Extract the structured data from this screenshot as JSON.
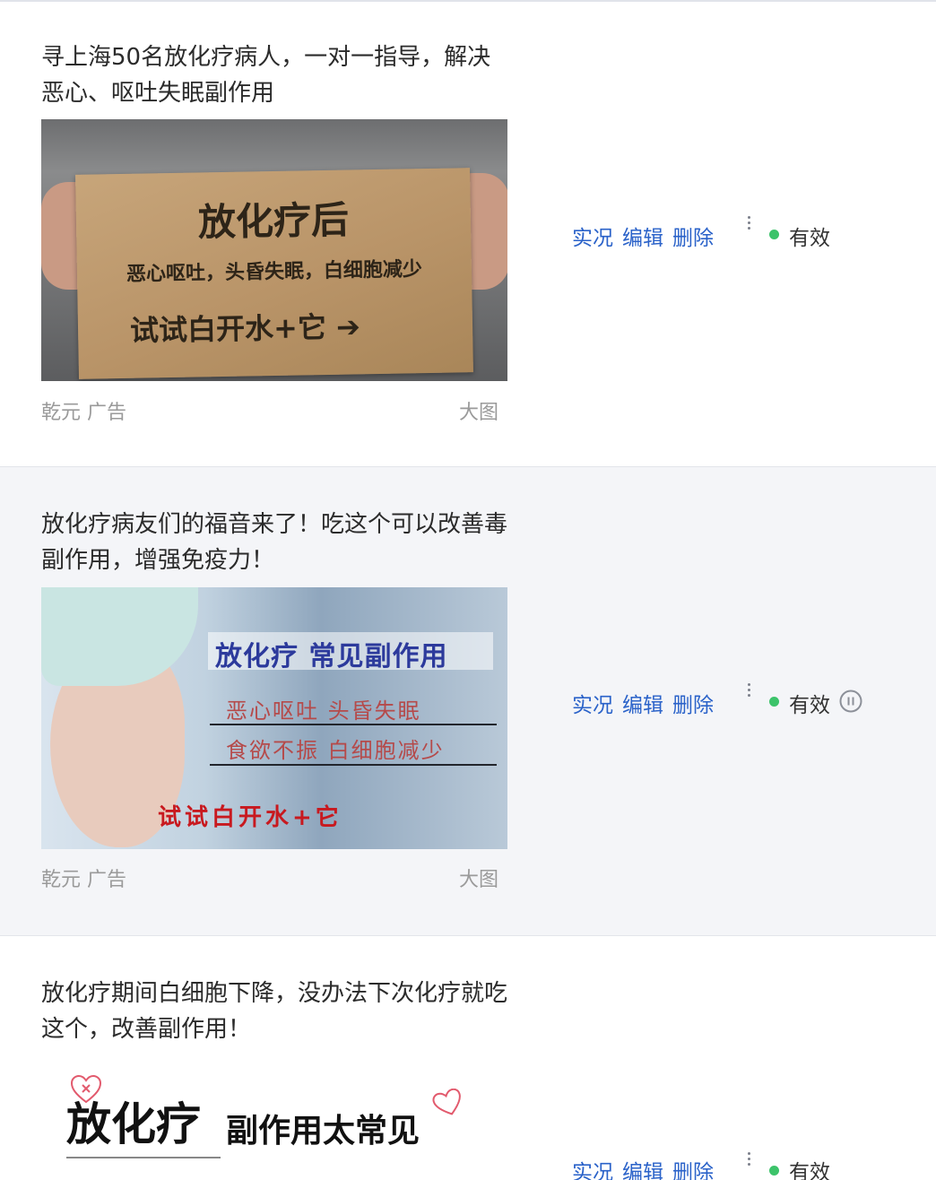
{
  "ads": [
    {
      "title": "寻上海50名放化疗病人，一对一指导，解决恶心、呕吐失眠副作用",
      "image": {
        "heading": "放化疗后",
        "subheading": "恶心呕吐，头昏失眠，白细胞减少",
        "cta": "试试白开水+它 ➔"
      },
      "source": "乾元 广告",
      "format": "大图",
      "actions": [
        "实况",
        "编辑",
        "删除"
      ],
      "status": "有效",
      "status_color": "#3cc36a",
      "show_pause": false
    },
    {
      "title": "放化疗病友们的福音来了！吃这个可以改善毒副作用，增强免疫力！",
      "image": {
        "heading": "放化疗 常见副作用",
        "line1": "恶心呕吐  头昏失眠",
        "line2": "食欲不振  白细胞减少",
        "cta": "试试白开水+它"
      },
      "source": "乾元 广告",
      "format": "大图",
      "actions": [
        "实况",
        "编辑",
        "删除"
      ],
      "status": "有效",
      "status_color": "#3cc36a",
      "show_pause": true
    },
    {
      "title": "放化疗期间白细胞下降，没办法下次化疗就吃这个，改善副作用！",
      "image": {
        "heading": "放化疗",
        "subheading": "副作用太常见"
      },
      "actions": [
        "实况",
        "编辑",
        "删除"
      ],
      "status": "有效",
      "status_color": "#3cc36a",
      "show_pause": false
    }
  ],
  "colors": {
    "link": "#2a62c9",
    "alt_row_bg": "#f4f5f8",
    "meta_text": "#9a9a9a"
  }
}
